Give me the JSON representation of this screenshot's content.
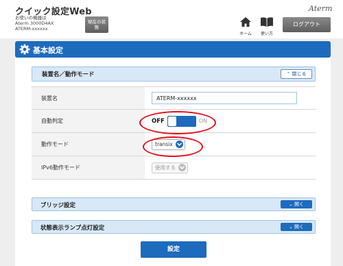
{
  "header": {
    "app_title": "クイック設定Web",
    "model_line1": "お使いの機器は",
    "model_line2": "Aterm 3000D4AX",
    "model_line3": "ATERM-xxxxxx",
    "status_button": "現在の状態",
    "brand": "Aterm",
    "home_label": "ホーム",
    "guide_label": "使い方",
    "logout_label": "ログアウト"
  },
  "section": {
    "title": "基本設定"
  },
  "accordion_open": {
    "title": "装置名／動作モード",
    "close_label": "閉じる"
  },
  "rows": {
    "device_name": {
      "label": "装置名",
      "value": "ATERM-xxxxxx"
    },
    "auto_detect": {
      "label": "自動判定",
      "off_label": "OFF",
      "on_label": "ON",
      "state": "OFF"
    },
    "operation_mode": {
      "label": "動作モード",
      "value": "transix"
    },
    "ipv6_mode": {
      "label": "IPv6動作モード",
      "value": "使用する"
    }
  },
  "accordions_closed": [
    {
      "title": "ブリッジ設定",
      "open_label": "開く"
    },
    {
      "title": "状態表示ランプ点灯設定",
      "open_label": "開く"
    }
  ],
  "submit": {
    "label": "設定"
  },
  "colors": {
    "primary": "#1d6bbd",
    "highlight": "#e3111b",
    "accordion_bg": "#d8e8f7"
  }
}
